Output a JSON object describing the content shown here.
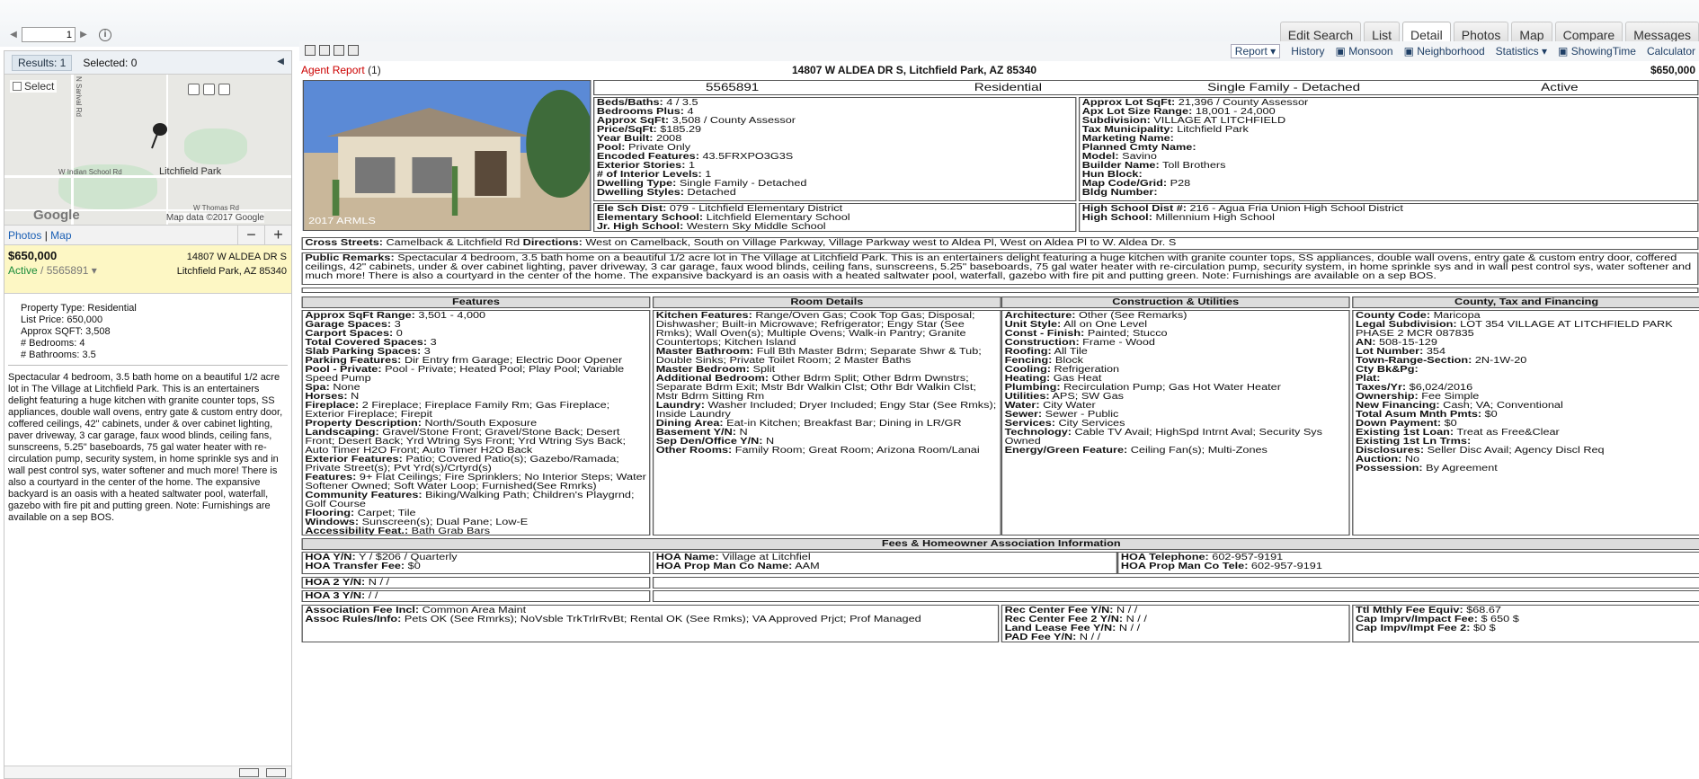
{
  "pager": {
    "page": "1"
  },
  "tabs": [
    "Edit Search",
    "List",
    "Detail",
    "Photos",
    "Map",
    "Compare",
    "Messages"
  ],
  "active_tab": "Detail",
  "left": {
    "results": "Results: 1",
    "selected": "Selected: 0",
    "map": {
      "select": "Select",
      "roads": [
        "N Sarival Rd",
        "W Indian School Rd",
        "W Thomas Rd"
      ],
      "city": "Litchfield Park",
      "google": "Google",
      "copyright": "Map data ©2017 Google"
    },
    "photos": "Photos",
    "map_link": "Map",
    "price": "$650,000",
    "status": "Active",
    "mls": "5565891",
    "address1": "14807 W ALDEA DR S",
    "address2": "Litchfield Park, AZ 85340",
    "summary": [
      {
        "label": "Property Type:",
        "value": "Residential"
      },
      {
        "label": "List Price:",
        "value": "650,000"
      },
      {
        "label": "Approx SQFT:",
        "value": "3,508"
      },
      {
        "label": "# Bedrooms:",
        "value": "4"
      },
      {
        "label": "# Bathrooms:",
        "value": "3.5"
      }
    ],
    "description": "Spectacular 4 bedroom, 3.5 bath home on a beautiful 1/2 acre lot in The Village at Litchfield Park. This is an entertainers delight featuring a huge kitchen with granite counter tops, SS appliances, double wall ovens, entry gate & custom entry door, coffered ceilings, 42\" cabinets, under & over cabinet lighting, paver driveway, 3 car garage, faux wood blinds, ceiling fans, sunscreens, 5.25\" baseboards, 75 gal water heater with re-circulation pump, security system, in home sprinkle sys and in wall pest control sys, water softener and much more! There is also a courtyard in the center of the home. The expansive backyard is an oasis with a heated saltwater pool, waterfall, gazebo with fire pit and putting green. Note: Furnishings are available on a sep BOS."
  },
  "toolbar": {
    "report": "Report",
    "history": "History",
    "monsoon": "Monsoon",
    "neighborhood": "Neighborhood",
    "statistics": "Statistics",
    "showing": "ShowingTime",
    "calculator": "Calculator"
  },
  "report": {
    "title": "Agent Report",
    "count": "(1)",
    "address": "14807 W ALDEA DR S, Litchfield Park, AZ 85340",
    "price": "$650,000",
    "photo_caption": "2017 ARMLS",
    "header": [
      "5565891",
      "Residential",
      "Single Family - Detached",
      "Active"
    ],
    "col1": [
      [
        "Beds/Baths:",
        "4 / 3.5"
      ],
      [
        "Bedrooms Plus:",
        "4"
      ],
      [
        "Approx SqFt:",
        "3,508 / County Assessor"
      ],
      [
        "Price/SqFt:",
        "$185.29"
      ],
      [
        "Year Built:",
        "2008"
      ],
      [
        "Pool:",
        "Private Only"
      ],
      [
        "Encoded Features:",
        "43.5FRXPO3G3S"
      ],
      [
        "Exterior Stories:",
        "1"
      ],
      [
        "# of Interior Levels:",
        "1"
      ],
      [
        "Dwelling Type:",
        "Single Family - Detached"
      ],
      [
        "Dwelling Styles:",
        "Detached"
      ]
    ],
    "col2": [
      [
        "Approx Lot SqFt:",
        "21,396 / County Assessor"
      ],
      [
        "Apx Lot Size Range:",
        "18,001 - 24,000"
      ],
      [
        "Subdivision:",
        "VILLAGE AT LITCHFIELD"
      ],
      [
        "Tax Municipality:",
        "Litchfield Park"
      ],
      [
        "Marketing Name:",
        ""
      ],
      [
        "Planned Cmty Name:",
        ""
      ],
      [
        "Model:",
        "Savino"
      ],
      [
        "Builder Name:",
        "Toll Brothers"
      ],
      [
        "Hun Block:",
        ""
      ],
      [
        "Map Code/Grid:",
        "P28"
      ],
      [
        "Bldg Number:",
        ""
      ]
    ],
    "schools1": [
      [
        "Ele Sch Dist:",
        "079 - Litchfield Elementary District"
      ],
      [
        "Elementary School:",
        "Litchfield Elementary School"
      ],
      [
        "Jr. High School:",
        "Western Sky Middle School"
      ]
    ],
    "schools2": [
      [
        "High School Dist #:",
        "216 - Agua Fria Union High School District"
      ],
      [
        "High School:",
        "Millennium High School"
      ]
    ],
    "cross_label": "Cross Streets:",
    "cross": "Camelback & Litchfield Rd",
    "dir_label": "Directions:",
    "directions": "West on Camelback, South on Village Parkway, Village Parkway west to Aldea Pl, West on Aldea Pl to W. Aldea Dr. S",
    "remarks_label": "Public Remarks:",
    "remarks": "Spectacular 4 bedroom, 3.5 bath home on a beautiful 1/2 acre lot in The Village at Litchfield Park. This is an entertainers delight featuring a huge kitchen with granite counter tops, SS appliances, double wall ovens, entry gate & custom entry door, coffered ceilings, 42\" cabinets, under & over cabinet lighting, paver driveway, 3 car garage, faux wood blinds, ceiling fans, sunscreens, 5.25\" baseboards, 75 gal water heater with re-circulation pump, security system, in home sprinkle sys and in wall pest control sys, water softener and much more! There is also a courtyard in the center of the home. The expansive backyard is an oasis with a heated saltwater pool, waterfall, gazebo with fire pit and putting green. Note: Furnishings are available on a sep BOS.",
    "sections": [
      "Features",
      "Room Details",
      "Construction & Utilities",
      "County, Tax and Financing"
    ],
    "features": [
      [
        "Approx SqFt Range:",
        "3,501 - 4,000"
      ],
      [
        "Garage Spaces:",
        "3"
      ],
      [
        "Carport Spaces:",
        "0"
      ],
      [
        "Total Covered Spaces:",
        "3"
      ],
      [
        "Slab Parking Spaces:",
        "3"
      ],
      [
        "Parking Features:",
        "Dir Entry frm Garage; Electric Door Opener"
      ],
      [
        "Pool - Private:",
        "Pool - Private; Heated Pool; Play Pool; Variable Speed Pump"
      ],
      [
        "Spa:",
        "None"
      ],
      [
        "Horses:",
        "N"
      ],
      [
        "Fireplace:",
        "2 Fireplace; Fireplace Family Rm; Gas Fireplace; Exterior Fireplace; Firepit"
      ],
      [
        "Property Description:",
        "North/South Exposure"
      ],
      [
        "Landscaping:",
        "Gravel/Stone Front; Gravel/Stone Back; Desert Front; Desert Back; Yrd Wtring Sys Front; Yrd Wtring Sys Back; Auto Timer H2O Front; Auto Timer H2O Back"
      ],
      [
        "Exterior Features:",
        "Patio; Covered Patio(s); Gazebo/Ramada; Private Street(s); Pvt Yrd(s)/Crtyrd(s)"
      ],
      [
        "Features:",
        "9+ Flat Ceilings; Fire Sprinklers; No Interior Steps; Water Softener Owned; Soft Water Loop; Furnished(See Rmrks)"
      ],
      [
        "Community Features:",
        "Biking/Walking Path; Children's Playgrnd; Golf Course"
      ],
      [
        "Flooring:",
        "Carpet; Tile"
      ],
      [
        "Windows:",
        "Sunscreen(s); Dual Pane; Low-E"
      ],
      [
        "Accessibility Feat.:",
        "Bath Grab Bars"
      ]
    ],
    "rooms": [
      [
        "Kitchen Features:",
        "Range/Oven Gas; Cook Top Gas; Disposal; Dishwasher; Built-in Microwave; Refrigerator; Engy Star (See Rmks); Wall Oven(s); Multiple Ovens; Walk-in Pantry; Granite Countertops; Kitchen Island"
      ],
      [
        "Master Bathroom:",
        "Full Bth Master Bdrm; Separate Shwr & Tub; Double Sinks; Private Toilet Room; 2 Master Baths"
      ],
      [
        "Master Bedroom:",
        "Split"
      ],
      [
        "Additional Bedroom:",
        "Other Bdrm Split; Other Bdrm Dwnstrs; Separate Bdrm Exit; Mstr Bdr Walkin Clst; Othr Bdr Walkin Clst; Mstr Bdrm Sitting Rm"
      ],
      [
        "Laundry:",
        "Washer Included; Dryer Included; Engy Star (See Rmks); Inside Laundry"
      ],
      [
        "Dining Area:",
        "Eat-in Kitchen; Breakfast Bar; Dining in LR/GR"
      ],
      [
        "Basement Y/N:",
        "N"
      ],
      [
        "Sep Den/Office Y/N:",
        "N"
      ],
      [
        "Other Rooms:",
        "Family Room; Great Room; Arizona Room/Lanai"
      ]
    ],
    "construction": [
      [
        "Architecture:",
        "Other (See Remarks)"
      ],
      [
        "Unit Style:",
        "All on One Level"
      ],
      [
        "Const - Finish:",
        "Painted; Stucco"
      ],
      [
        "Construction:",
        "Frame - Wood"
      ],
      [
        "Roofing:",
        "All Tile"
      ],
      [
        "Fencing:",
        "Block"
      ],
      [
        "Cooling:",
        "Refrigeration"
      ],
      [
        "Heating:",
        "Gas Heat"
      ],
      [
        "Plumbing:",
        "Recirculation Pump; Gas Hot Water Heater"
      ],
      [
        "Utilities:",
        "APS; SW Gas"
      ],
      [
        "Water:",
        "City Water"
      ],
      [
        "Sewer:",
        "Sewer - Public"
      ],
      [
        "Services:",
        "City Services"
      ],
      [
        "Technology:",
        "Cable TV Avail; HighSpd Intrnt Aval; Security Sys Owned"
      ],
      [
        "Energy/Green Feature:",
        "Ceiling Fan(s); Multi-Zones"
      ]
    ],
    "county": [
      [
        "County Code:",
        "Maricopa"
      ],
      [
        "Legal Subdivision:",
        "LOT 354 VILLAGE AT LITCHFIELD PARK PHASE 2 MCR 087835"
      ],
      [
        "AN:",
        "508-15-129"
      ],
      [
        "Lot Number:",
        "354"
      ],
      [
        "Town-Range-Section:",
        "2N-1W-20"
      ],
      [
        "Cty Bk&Pg:",
        ""
      ],
      [
        "Plat:",
        ""
      ],
      [
        "Taxes/Yr:",
        "$6,024/2016"
      ],
      [
        "Ownership:",
        "Fee Simple"
      ],
      [
        "New Financing:",
        "Cash; VA; Conventional"
      ],
      [
        "Total Asum Mnth Pmts:",
        "$0"
      ],
      [
        "Down Payment:",
        "$0"
      ],
      [
        "Existing 1st Loan:",
        "Treat as Free&Clear"
      ],
      [
        "Existing 1st Ln Trms:",
        ""
      ],
      [
        "Disclosures:",
        "Seller Disc Avail; Agency Discl Req"
      ],
      [
        "Auction:",
        "No"
      ],
      [
        "Possession:",
        "By Agreement"
      ]
    ],
    "fees_title": "Fees & Homeowner Association Information",
    "hoa1": [
      [
        "HOA Y/N:",
        "Y / $206 / Quarterly"
      ],
      [
        "HOA Transfer Fee:",
        "$0"
      ]
    ],
    "hoa_name": [
      [
        "HOA Name:",
        "Village at Litchfiel"
      ],
      [
        "HOA Prop Man Co Name:",
        "AAM"
      ]
    ],
    "hoa_tel": [
      [
        "HOA Telephone:",
        "602-957-9191"
      ],
      [
        "HOA Prop Man Co Tele:",
        "602-957-9191"
      ]
    ],
    "hoa2": [
      [
        "HOA 2 Y/N:",
        "N / /"
      ]
    ],
    "hoa3": [
      [
        "HOA 3 Y/N:",
        "/ /"
      ]
    ],
    "assoc": [
      [
        "Association Fee Incl:",
        "Common Area Maint"
      ],
      [
        "Assoc Rules/Info:",
        "Pets OK (See Rmrks); NoVsble TrkTrlrRvBt; Rental OK (See Rmks); VA Approved Prjct; Prof Managed"
      ]
    ],
    "rec": [
      [
        "Rec Center Fee Y/N:",
        "N / /"
      ],
      [
        "Rec Center Fee 2 Y/N:",
        "N / /"
      ],
      [
        "Land Lease Fee Y/N:",
        "N / /"
      ],
      [
        "PAD Fee Y/N:",
        "N / /"
      ]
    ],
    "ttl": [
      [
        "Ttl Mthly Fee Equiv:",
        "$68.67"
      ],
      [
        "Cap Imprv/Impact Fee:",
        "$ 650 $"
      ],
      [
        "Cap Impv/Impt Fee 2:",
        "$0 $"
      ]
    ]
  }
}
